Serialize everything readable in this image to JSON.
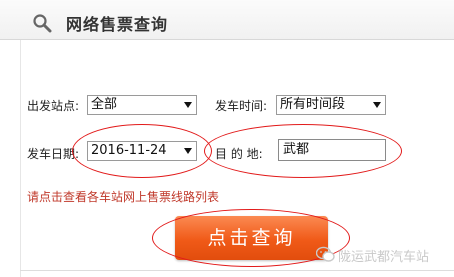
{
  "header": {
    "title": "网络售票查询",
    "icon": "search-icon"
  },
  "form": {
    "origin_label": "出发站点:",
    "origin_value": "全部",
    "time_label": "发车时间:",
    "time_value": "所有时间段",
    "date_label": "发车日期:",
    "date_value": "2016-11-24",
    "destination_label": "目 的 地:",
    "destination_value": "武都"
  },
  "link_text": "请点击查看各车站网上售票线路列表",
  "query_button_label": "点击查询",
  "watermark": {
    "text": "陇运武都汽车站",
    "icon": "wechat-icon"
  },
  "colors": {
    "accent": "#f05a18",
    "link": "#c0392b",
    "annotation": "#e21b1b"
  }
}
